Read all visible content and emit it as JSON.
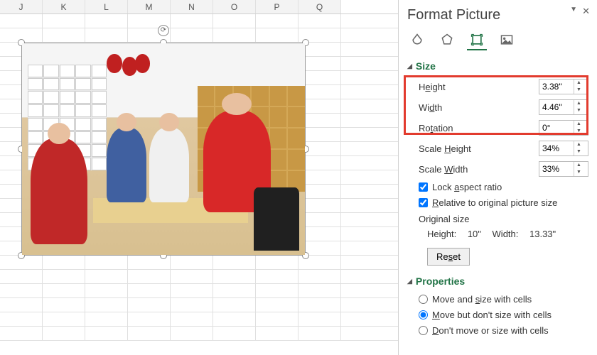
{
  "columns": [
    "J",
    "K",
    "L",
    "M",
    "N",
    "O",
    "P",
    "Q"
  ],
  "panel": {
    "title": "Format Picture",
    "sections": {
      "size": {
        "title": "Size",
        "height_label": "Height",
        "height_value": "3.38\"",
        "width_label": "Width",
        "width_value": "4.46\"",
        "rotation_label": "Rotation",
        "rotation_value": "0°",
        "scale_height_label": "Scale Height",
        "scale_height_value": "34%",
        "scale_width_label": "Scale Width",
        "scale_width_value": "33%",
        "lock_aspect": "Lock aspect ratio",
        "relative_orig": "Relative to original picture size",
        "original_size": "Original size",
        "orig_height_label": "Height:",
        "orig_height_value": "10\"",
        "orig_width_label": "Width:",
        "orig_width_value": "13.33\"",
        "reset": "Reset"
      },
      "properties": {
        "title": "Properties",
        "opt1": "Move and size with cells",
        "opt2": "Move but don't size with cells",
        "opt3": "Don't move or size with cells"
      }
    }
  }
}
